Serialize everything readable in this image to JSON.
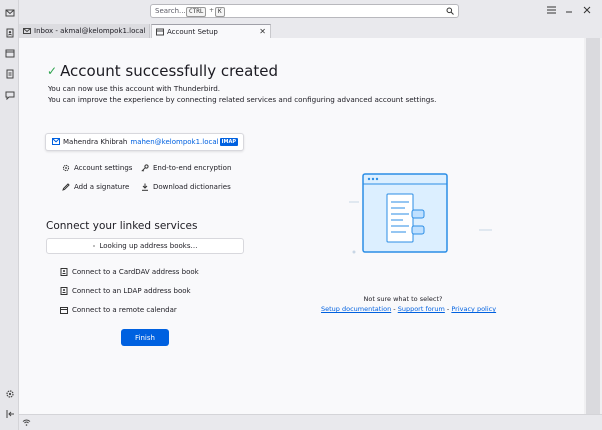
{
  "search": {
    "placeholder": "Search...",
    "shortcut_key1": "CTRL",
    "shortcut_plus": "+",
    "shortcut_key2": "K"
  },
  "tabs": [
    {
      "label": "Inbox - akmal@kelompok1.local",
      "active": false
    },
    {
      "label": "Account Setup",
      "active": true
    }
  ],
  "main": {
    "title": "Account successfully created",
    "subtitle1": "You can now use this account with Thunderbird.",
    "subtitle2": "You can improve the experience by connecting related services and configuring advanced account settings."
  },
  "account": {
    "name": "Mahendra Khibrah",
    "email": "mahen@kelompok1.local",
    "protocol": "IMAP"
  },
  "actions": {
    "account_settings": "Account settings",
    "e2e": "End-to-end encryption",
    "signature": "Add a signature",
    "dictionaries": "Download dictionaries"
  },
  "linked": {
    "title": "Connect your linked services",
    "lookup": "Looking up address books…",
    "carddav": "Connect to a CardDAV address book",
    "ldap": "Connect to an LDAP address book",
    "calendar": "Connect to a remote calendar"
  },
  "finish_label": "Finish",
  "help": {
    "question": "Not sure what to select?",
    "doc": "Setup documentation",
    "sep1": " - ",
    "forum": "Support forum",
    "sep2": " - ",
    "privacy": "Privacy policy"
  },
  "colors": {
    "accent": "#0061e0",
    "success": "#2ea44f",
    "illustration": "#dcefff"
  },
  "icons": {
    "spaces": [
      "mail-icon",
      "address-book-icon",
      "calendar-icon",
      "tasks-icon",
      "chat-icon",
      "settings-icon",
      "collapse-icon"
    ],
    "status": "wifi-icon"
  }
}
